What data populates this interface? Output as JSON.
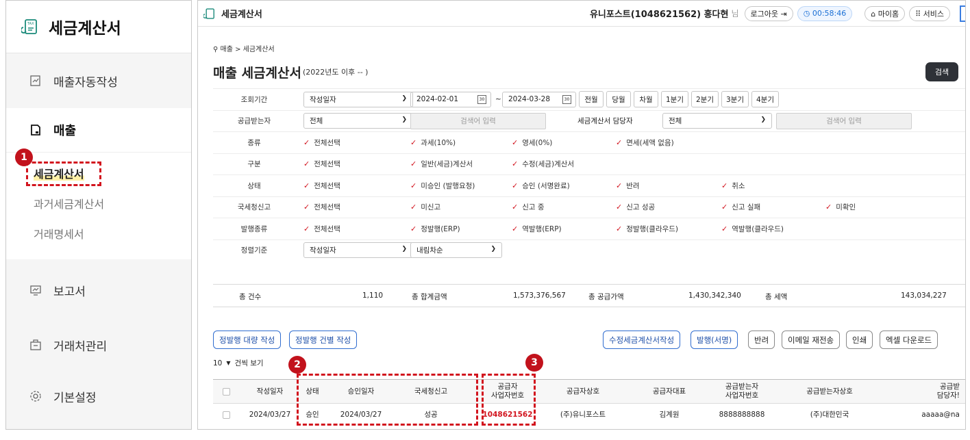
{
  "sidebar": {
    "app_title": "세금계산서",
    "logo_icon": "tax-icon",
    "auto_label": "매출자동작성",
    "sales_label": "매출",
    "sub_items": [
      "세금계산서",
      "과거세금계산서",
      "거래명세서"
    ],
    "report_label": "보고서",
    "partner_label": "거래처관리",
    "settings_label": "기본설정"
  },
  "annotations": [
    "1",
    "2",
    "3"
  ],
  "topbar": {
    "title": "세금계산서",
    "user": "유니포스트(1048621562) 홍다현",
    "honorific": "님",
    "logout": "로그아웃 ⇥",
    "timer": "◷ 00:58:46",
    "mypage": "⌂ 마이홈",
    "service": "⠿ 서비스"
  },
  "breadcrumb": "⚲ 매출 > 세금계산서",
  "page": {
    "title": "매출 세금계산서",
    "subtitle": "(2022년도 이후 -- )",
    "search_btn": "검색"
  },
  "filters": {
    "period_label": "조회기간",
    "period_type": "작성일자",
    "date_from": "2024-02-01",
    "date_sep": "~",
    "date_to": "2024-03-28",
    "period_buttons": [
      "전월",
      "당월",
      "차월",
      "1분기",
      "2분기",
      "3분기",
      "4분기"
    ],
    "buyer_label": "공급받는자",
    "buyer_value": "전체",
    "buyer_placeholder": "검색어 입력",
    "manager_label": "세금계산서 담당자",
    "manager_value": "전체",
    "manager_placeholder": "검색어 입력",
    "type_label": "종류",
    "type_opts": [
      "전체선택",
      "과세(10%)",
      "영세(0%)",
      "면세(세액 없음)"
    ],
    "kind_label": "구분",
    "kind_opts": [
      "전체선택",
      "일반(세금)계산서",
      "수정(세금)계산서"
    ],
    "status_label": "상태",
    "status_opts": [
      "전체선택",
      "미승인 (발행요청)",
      "승인 (서명완료)",
      "반려",
      "취소"
    ],
    "nts_label": "국세청신고",
    "nts_opts": [
      "전체선택",
      "미신고",
      "신고 중",
      "신고 성공",
      "신고 실패",
      "미확인"
    ],
    "issue_label": "발행종류",
    "issue_opts": [
      "전체선택",
      "정발행(ERP)",
      "역발행(ERP)",
      "정발행(클라우드)",
      "역발행(클라우드)"
    ],
    "sort_label": "정렬기준",
    "sort_field": "작성일자",
    "sort_order": "내림차순"
  },
  "totals": {
    "count_label": "총 건수",
    "count": "1,110",
    "sum_label": "총 합계금액",
    "sum": "1,573,376,567",
    "supply_label": "총 공급가액",
    "supply": "1,430,342,340",
    "tax_label": "총 세액",
    "tax": "143,034,227"
  },
  "actions": {
    "bulk": "정발행 대량 작성",
    "single": "정발행 건별 작성",
    "amend": "수정세금계산서작성",
    "issue": "발행(서명)",
    "reject": "반려",
    "resend": "이메일 재전송",
    "print": "인쇄",
    "excel": "엑셀 다운로드"
  },
  "per_page": {
    "value": "10",
    "label": "건씩 보기"
  },
  "table": {
    "headers": [
      "작성일자",
      "상태",
      "승인일자",
      "국세청신고",
      "공급자\n사업자번호",
      "공급자상호",
      "공급자대표",
      "공급받는자\n사업자번호",
      "공급받는자상호",
      "공급받\n담당자!"
    ],
    "row": [
      "2024/03/27",
      "승인",
      "2024/03/27",
      "성공",
      "1048621562",
      "(주)유니포스트",
      "김계원",
      "8888888888",
      "(주)대한민국",
      "aaaaa@na"
    ]
  }
}
